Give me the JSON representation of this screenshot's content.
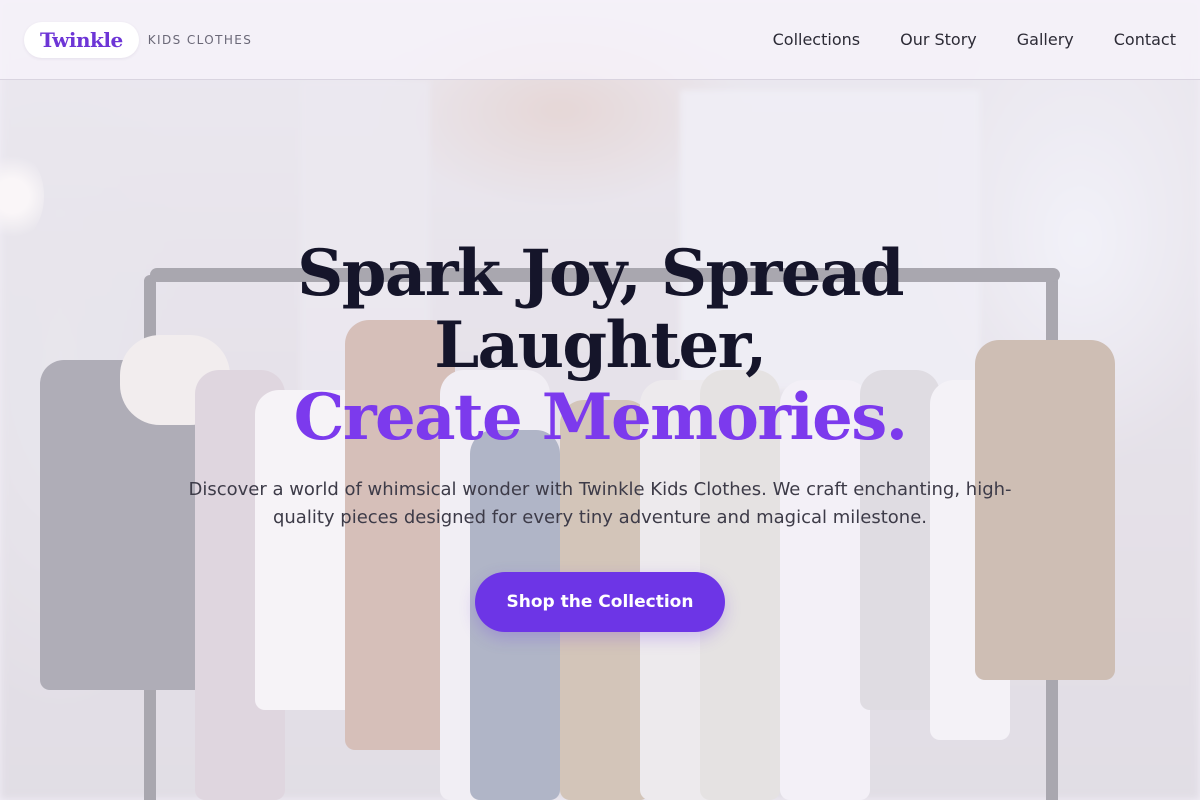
{
  "brand": {
    "logo_text": "Twinkle",
    "tagline": "KIDS CLOTHES"
  },
  "nav": {
    "items": [
      {
        "label": "Collections"
      },
      {
        "label": "Our Story"
      },
      {
        "label": "Gallery"
      },
      {
        "label": "Contact"
      }
    ]
  },
  "hero": {
    "headline_line1": "Spark Joy, Spread",
    "headline_line2": "Laughter,",
    "headline_accent": "Create Memories.",
    "subtext": "Discover a world of whimsical wonder with Twinkle Kids Clothes. We craft enchanting, high-quality pieces designed for every tiny adventure and magical milestone.",
    "cta_label": "Shop the Collection"
  },
  "colors": {
    "accent": "#7c3aed",
    "button": "#6d35e6",
    "heading": "#15152a",
    "body_text": "#3d3b48"
  }
}
